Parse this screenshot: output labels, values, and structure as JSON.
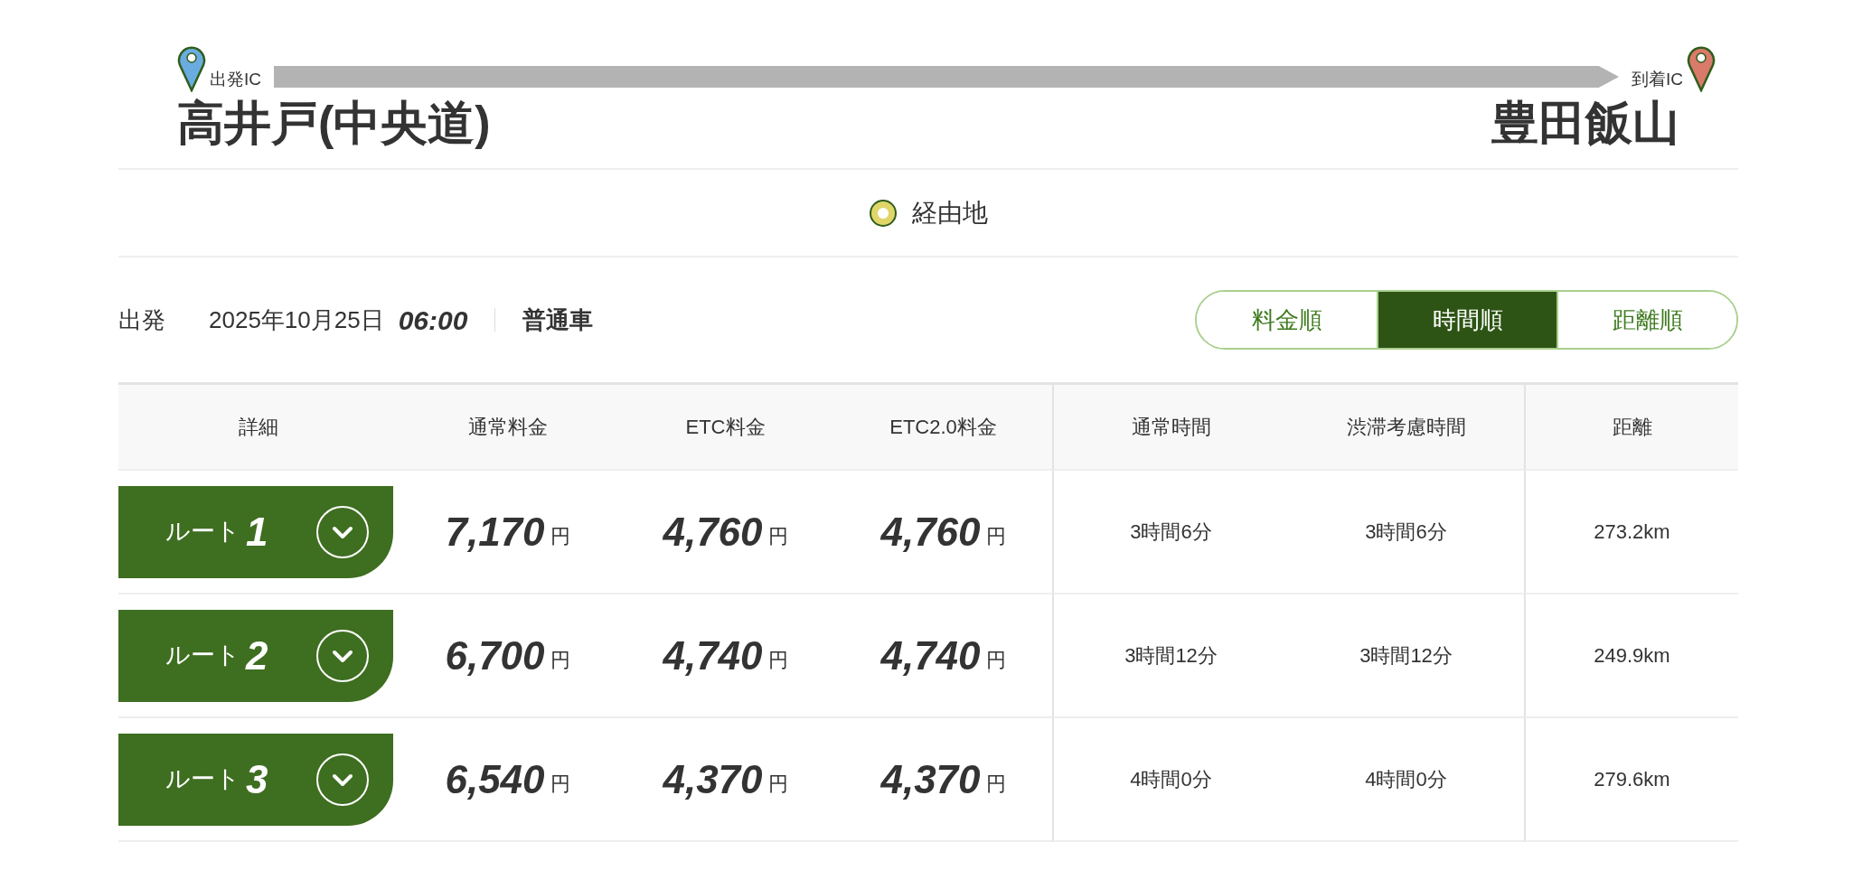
{
  "route": {
    "departure": {
      "label": "出発IC",
      "name": "高井戸(中央道)"
    },
    "arrival": {
      "label": "到着IC",
      "name": "豊田飯山"
    }
  },
  "waypoint": {
    "label": "経由地"
  },
  "conditions": {
    "departure_label": "出発",
    "date": "2025年10月25日",
    "time": "06:00",
    "vehicle": "普通車"
  },
  "sort_tabs": [
    {
      "label": "料金順",
      "selected": false
    },
    {
      "label": "時間順",
      "selected": true
    },
    {
      "label": "距離順",
      "selected": false
    }
  ],
  "table": {
    "columns": [
      "詳細",
      "通常料金",
      "ETC料金",
      "ETC2.0料金",
      "通常時間",
      "渋滞考慮時間",
      "距離"
    ],
    "rows": [
      {
        "route_label": "ルート",
        "route_number": "1",
        "fees": [
          {
            "amount": "7,170",
            "unit": "円"
          },
          {
            "amount": "4,760",
            "unit": "円"
          },
          {
            "amount": "4,760",
            "unit": "円"
          }
        ],
        "normal_time": "3時間6分",
        "congestion_time": "3時間6分",
        "distance": "273.2km"
      },
      {
        "route_label": "ルート",
        "route_number": "2",
        "fees": [
          {
            "amount": "6,700",
            "unit": "円"
          },
          {
            "amount": "4,740",
            "unit": "円"
          },
          {
            "amount": "4,740",
            "unit": "円"
          }
        ],
        "normal_time": "3時間12分",
        "congestion_time": "3時間12分",
        "distance": "249.9km"
      },
      {
        "route_label": "ルート",
        "route_number": "3",
        "fees": [
          {
            "amount": "6,540",
            "unit": "円"
          },
          {
            "amount": "4,370",
            "unit": "円"
          },
          {
            "amount": "4,370",
            "unit": "円"
          }
        ],
        "normal_time": "4時間0分",
        "congestion_time": "4時間0分",
        "distance": "279.6km"
      }
    ]
  }
}
